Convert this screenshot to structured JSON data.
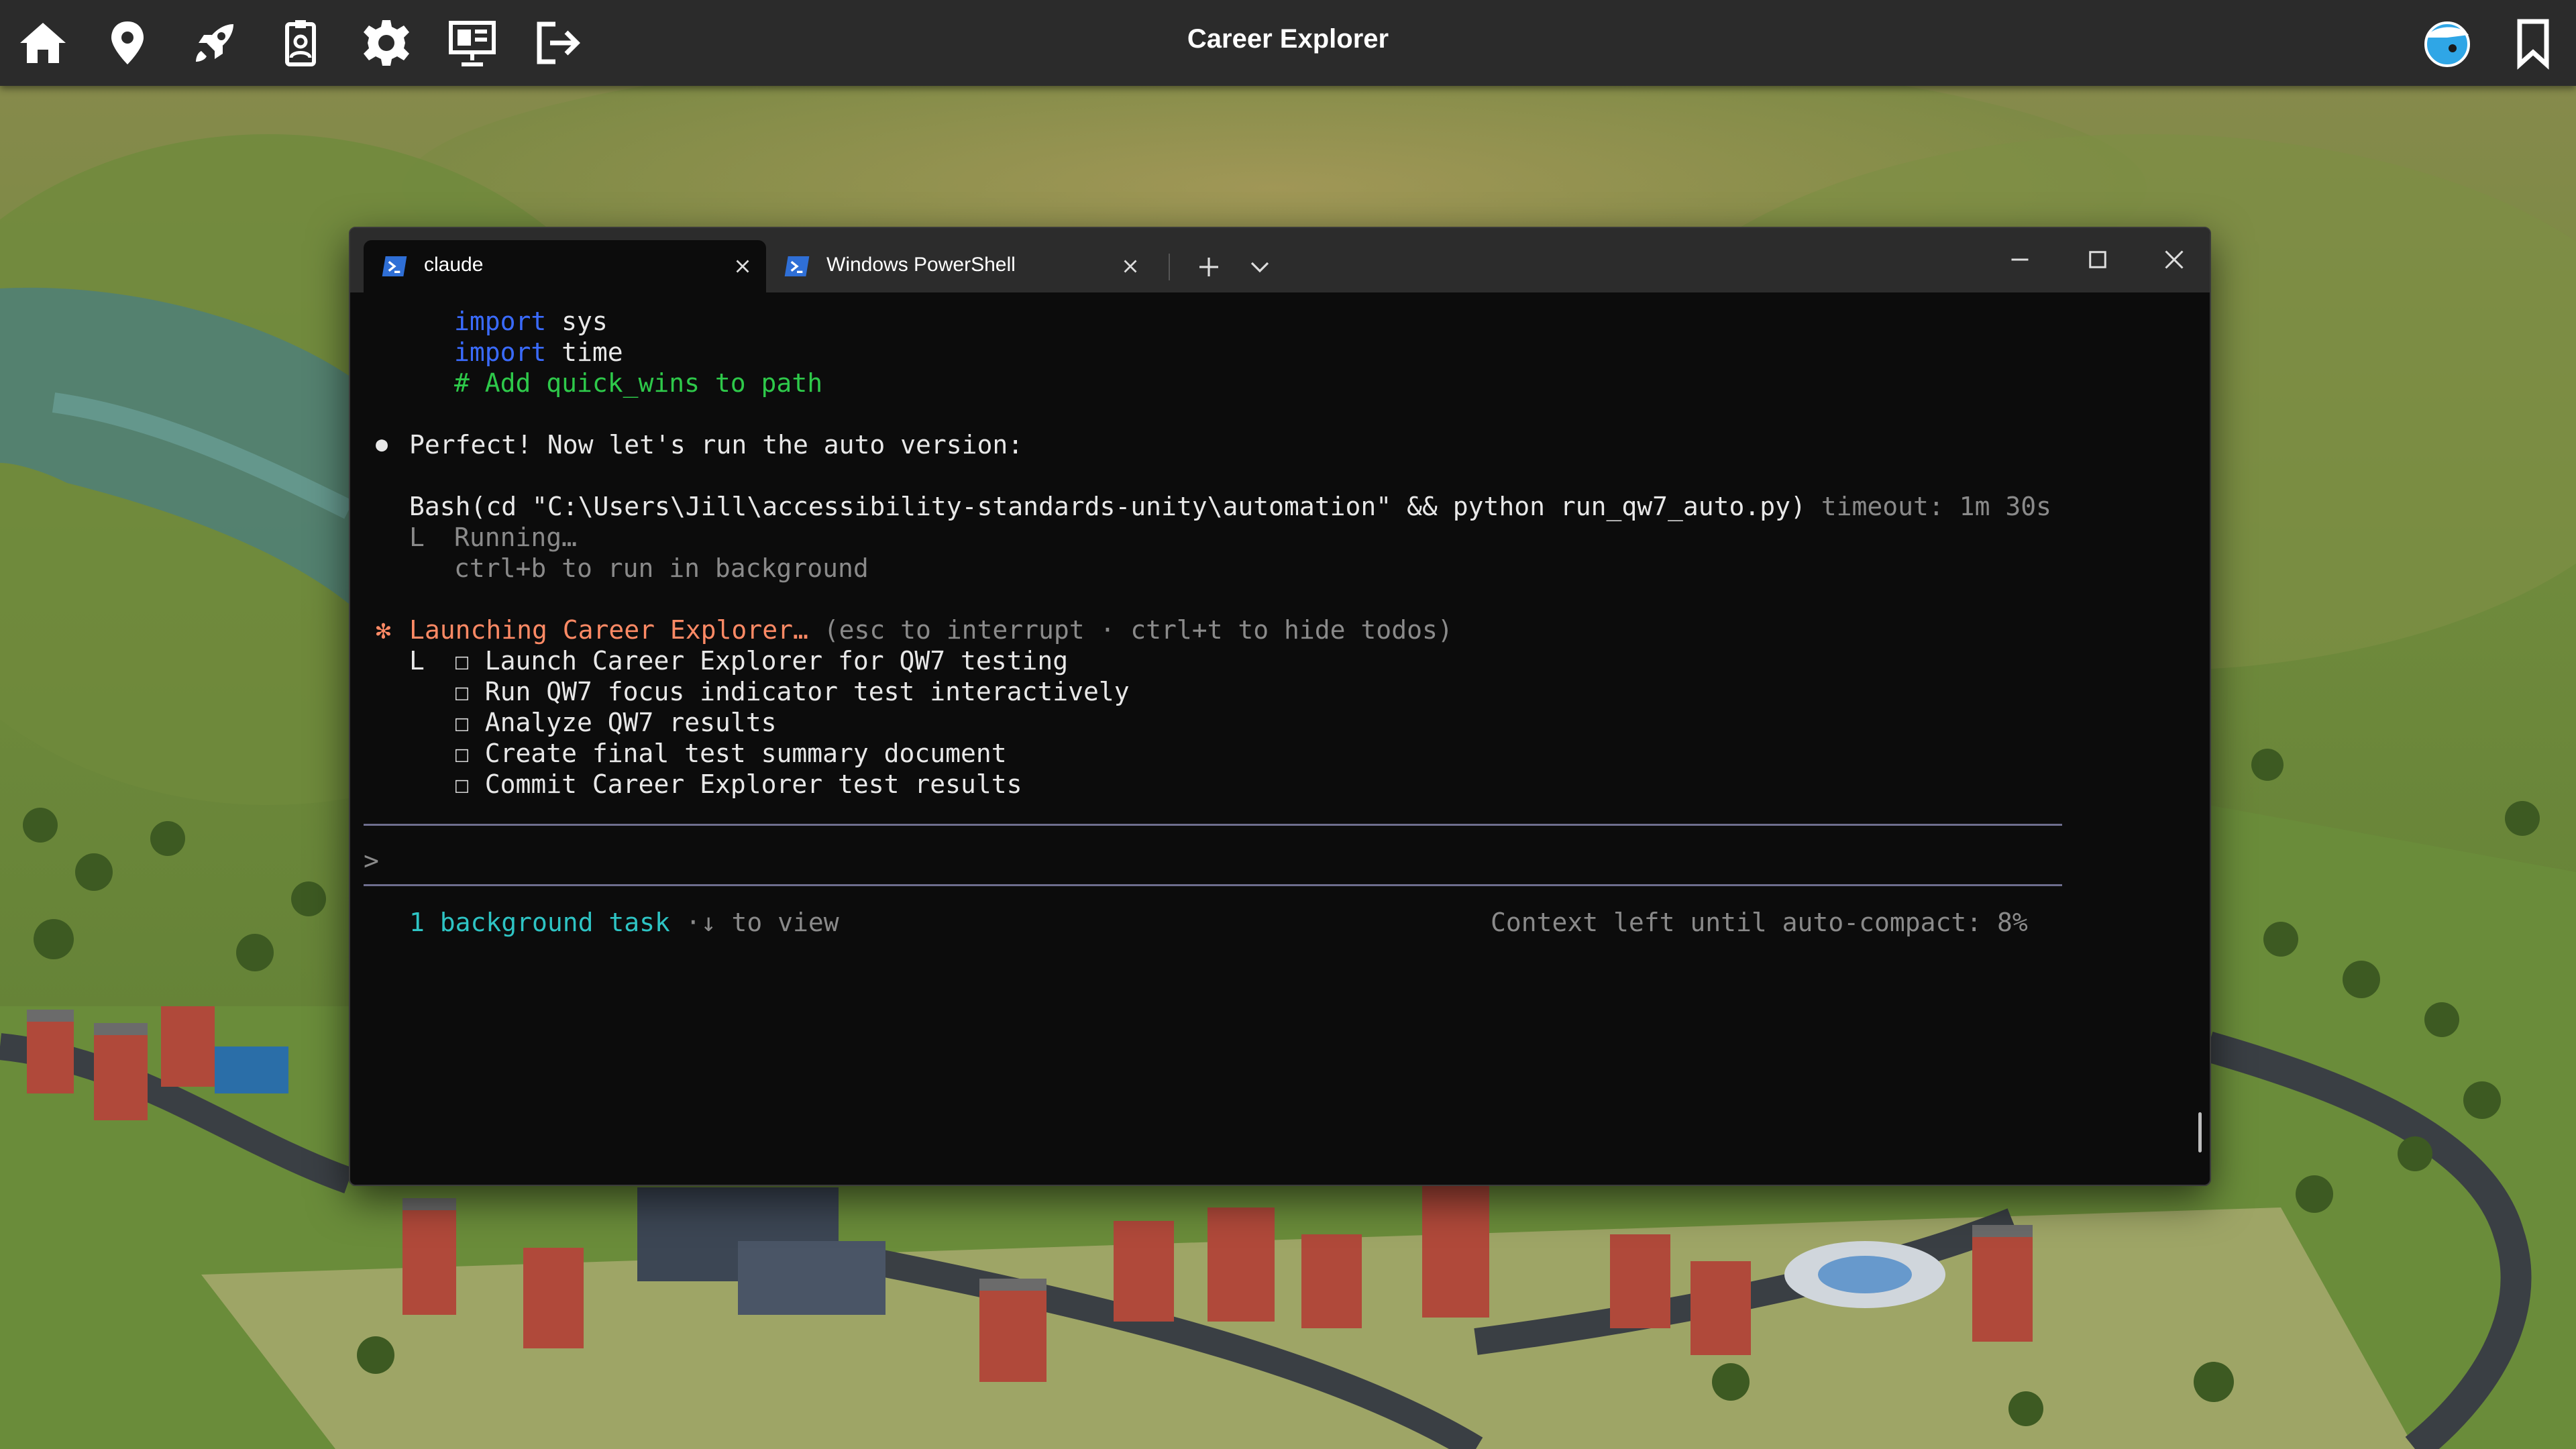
{
  "app": {
    "title": "Career Explorer",
    "icons": [
      "home-icon",
      "map-pin-icon",
      "rocket-icon",
      "badge-icon",
      "gear-icon",
      "presentation-icon",
      "logout-icon",
      "avatar-icon",
      "bookmark-icon"
    ]
  },
  "terminal": {
    "tabs": [
      {
        "label": "claude",
        "active": true
      },
      {
        "label": "Windows PowerShell",
        "active": false
      }
    ],
    "new_tab": "+",
    "code": {
      "line1_kw": "import",
      "line1_rest": " sys",
      "line2_kw": "import",
      "line2_rest": " time",
      "line3": "# Add quick_wins to path"
    },
    "bullet": "●",
    "message": "Perfect! Now let's run the auto version:",
    "bash_cmd": "Bash(cd \"C:\\Users\\Jill\\accessibility-standards-unity\\automation\" && python run_qw7_auto.py)",
    "bash_timeout": " timeout: 1m 30s",
    "tree_glyph": "L",
    "running": "Running…",
    "hint": "ctrl+b to run in background",
    "spinner": "✻",
    "status": "Launching Career Explorer…",
    "status_hint": " (esc to interrupt · ctrl+t to hide todos)",
    "checkbox": "☐",
    "todos": [
      "Launch Career Explorer for QW7 testing",
      "Run QW7 focus indicator test interactively",
      "Analyze QW7 results",
      "Create final test summary document",
      "Commit Career Explorer test results"
    ],
    "prompt": ">",
    "bg_tasks": "1 background task",
    "bg_hint": " ·↓ to view",
    "context": "Context left until auto-compact: 8%"
  },
  "colors": {
    "keyword": "#3a6bff",
    "comment": "#2ec94a",
    "status": "#ff8a65",
    "teal": "#2ec4c4"
  }
}
